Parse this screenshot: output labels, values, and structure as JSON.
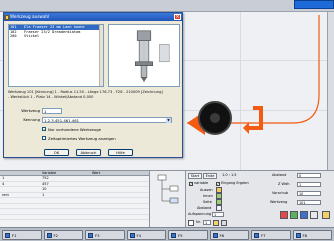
{
  "dialog": {
    "title": "Werkzeug auswahl",
    "tools": [
      {
        "num": "101",
        "name": "Ela Fraeser 23 mm Laen hoehe"
      },
      {
        "num": "102",
        "name": "Fraeser 23/2 Dreaderdiatam"
      },
      {
        "num": "200",
        "name": "Stickel"
      }
    ],
    "info_line_1": "Werkzeug 101 [Kennung] 1 - Radius 11.50 - Länge 176.73 - F28 - 210009 [Zeichnung]",
    "info_line_2": "- Werkstück 1 - Platz 14 - Winkel/Abstand 0.000",
    "werkzeug_label": "Werkzeug",
    "werkzeug_value": "1",
    "kennung_label": "Kennung",
    "kennung_value": "1.2.3.451.461.461",
    "checkbox_1": "Nur vorhandene Werkzeuge",
    "checkbox_2": "Zeitoptimiertes Werkzeug anzeigen",
    "ok_label": "OK",
    "cancel_label": "Abbruch",
    "help_label": "Hilfe"
  },
  "table": {
    "headers": [
      "",
      "Variable",
      "Wert"
    ],
    "rows": [
      {
        "a": "1",
        "b": "752",
        "c": ""
      },
      {
        "a": "4",
        "b": "457",
        "c": ""
      },
      {
        "a": "",
        "b": "10",
        "c": ""
      },
      {
        "a": "rect",
        "b": "1",
        "c": ""
      },
      {
        "a": "",
        "b": "",
        "c": ""
      },
      {
        "a": "",
        "b": "",
        "c": ""
      },
      {
        "a": "",
        "b": "",
        "c": ""
      },
      {
        "a": "",
        "b": "",
        "c": ""
      }
    ]
  },
  "props": {
    "start_label": "Start",
    "ende_label": "Ende",
    "range": "1.0 : 1.5",
    "chk_variable": "variable",
    "chk_eingang": "Eingang Ergebn",
    "aussen": "Aussen",
    "innen": "Innen",
    "seite": "Seite",
    "abstand": "Abstand",
    "abstand_label": "Abstand",
    "zahl_label": "Z Wdh",
    "vorschub_label": "Vorschub",
    "werkzeug_label": "Werkzeug",
    "abstand_val": "0",
    "zahl_val": "1",
    "vorschub_val": "10",
    "werkzeug_val": "101",
    "aufspann_label": "Aufspannung",
    "aufspann_val": "1",
    "nr_val": "1",
    "nr_label": "Nr."
  },
  "fkeys": [
    "F1",
    "F2",
    "F3",
    "F4",
    "F5",
    "F6",
    "F7",
    "F8"
  ],
  "colors": {
    "path_orange": "#f35a12",
    "title_blue": "#1f56b8",
    "selection": "#316ac5"
  }
}
